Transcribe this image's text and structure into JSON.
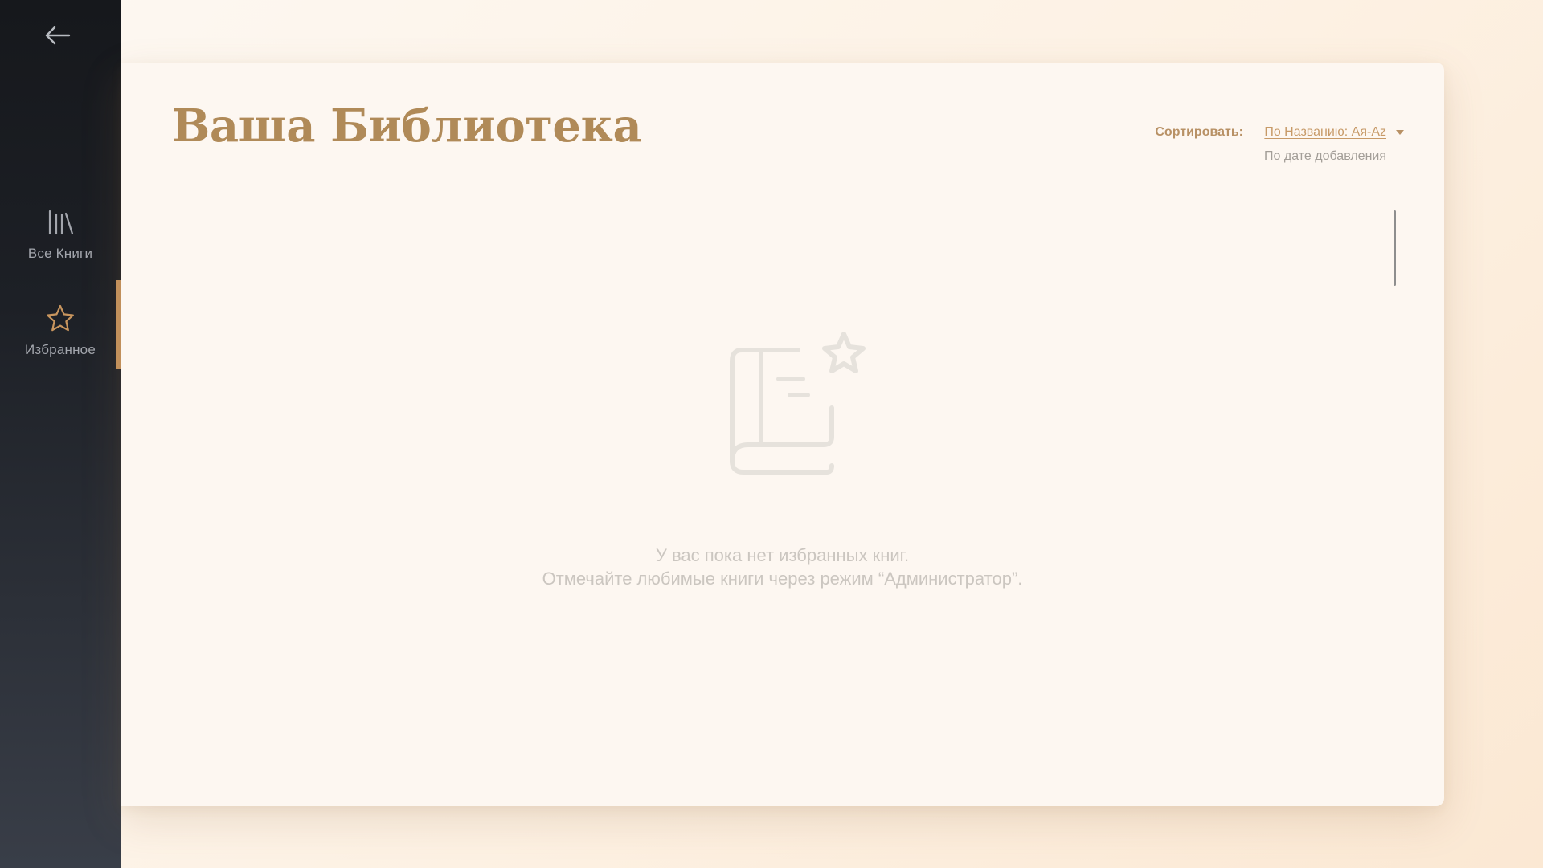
{
  "sidebar": {
    "back_icon": "arrow-left-icon",
    "items": [
      {
        "label": "Все Книги",
        "icon": "books-icon",
        "active": false
      },
      {
        "label": "Избранное",
        "icon": "star-icon",
        "active": true
      }
    ]
  },
  "main": {
    "title": "Ваша Библиотека",
    "sort": {
      "label": "Сортировать:",
      "selected": "По Названию: Ая-Az",
      "options": [
        "По дате добавления"
      ]
    },
    "empty_state": {
      "icon": "book-star-icon",
      "line1": "У вас пока нет избранных книг.",
      "line2": "Отмечайте любимые книги через режим “Администратор”."
    }
  },
  "colors": {
    "accent": "#c8955e",
    "title": "#b08a58",
    "sidebar_top": "#16181c",
    "sidebar_bottom": "#393e48",
    "background": "#fdf7f1"
  }
}
